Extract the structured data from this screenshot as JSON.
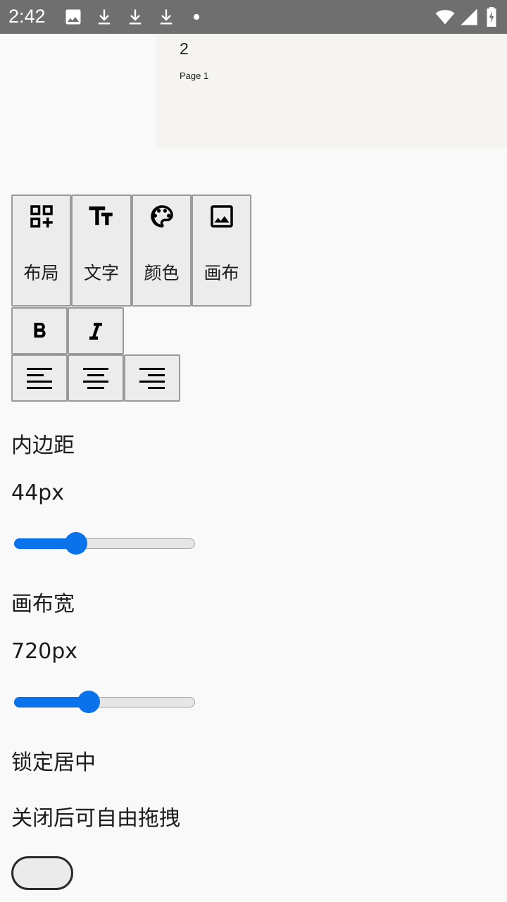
{
  "status_bar": {
    "time": "2:42",
    "icons": [
      "image-icon",
      "download-icon",
      "download-icon",
      "download-icon",
      "dot-icon",
      "wifi-icon",
      "signal-icon",
      "battery-charging-icon"
    ]
  },
  "preview": {
    "number": "2",
    "page_label": "Page 1"
  },
  "toolbar": {
    "tabs": [
      {
        "label": "布局",
        "icon": "layout-add-icon"
      },
      {
        "label": "文字",
        "icon": "text-size-icon"
      },
      {
        "label": "颜色",
        "icon": "palette-icon"
      },
      {
        "label": "画布",
        "icon": "image-icon"
      }
    ]
  },
  "format": {
    "bold_icon": "bold-icon",
    "italic_icon": "italic-icon",
    "align": [
      "align-left-icon",
      "align-center-icon",
      "align-right-icon"
    ]
  },
  "settings": {
    "padding_label": "内边距",
    "padding_value": "44px",
    "padding_level": 0.32,
    "canvas_width_label": "画布宽",
    "canvas_width_value": "720px",
    "canvas_width_level": 0.4,
    "lock_center_label": "锁定居中",
    "lock_center_hint": "关闭后可自由拖拽",
    "lock_center_on": false
  },
  "colors": {
    "accent": "#0a72ea",
    "status_bar": "#6f6f6f"
  }
}
